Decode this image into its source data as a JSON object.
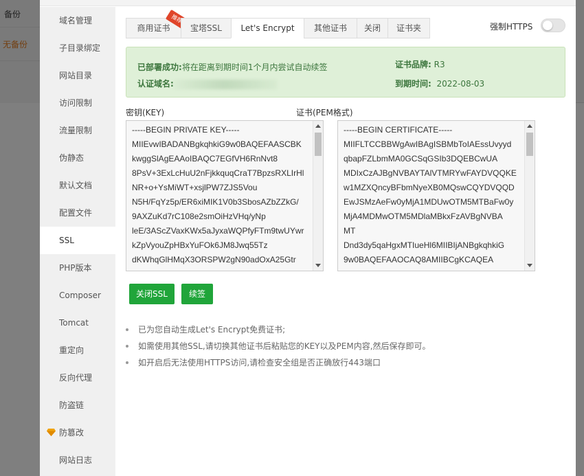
{
  "background": {
    "row1_label": "备份",
    "row2_label": "无备份"
  },
  "sidebar": {
    "items": [
      {
        "label": "域名管理"
      },
      {
        "label": "子目录绑定"
      },
      {
        "label": "网站目录"
      },
      {
        "label": "访问限制"
      },
      {
        "label": "流量限制"
      },
      {
        "label": "伪静态"
      },
      {
        "label": "默认文档"
      },
      {
        "label": "配置文件"
      },
      {
        "label": "SSL",
        "active": true
      },
      {
        "label": "PHP版本"
      },
      {
        "label": "Composer"
      },
      {
        "label": "Tomcat"
      },
      {
        "label": "重定向"
      },
      {
        "label": "反向代理"
      },
      {
        "label": "防盗链"
      },
      {
        "label": "防篡改",
        "icon": "gem-icon"
      },
      {
        "label": "网站日志"
      }
    ]
  },
  "tabs": [
    {
      "label": "商用证书",
      "badge": "推荐"
    },
    {
      "label": "宝塔SSL"
    },
    {
      "label": "Let's Encrypt",
      "active": true
    },
    {
      "label": "其他证书"
    },
    {
      "label": "关闭"
    },
    {
      "label": "证书夹"
    }
  ],
  "https_toggle": {
    "label": "强制HTTPS",
    "on": false
  },
  "info": {
    "status_label": "已部署成功:",
    "status_text": "将在距离到期时间1个月内尝试自动续签",
    "domain_label": "认证域名:",
    "brand_label": "证书品牌:",
    "brand_value": "R3",
    "expiry_label": "到期时间:",
    "expiry_value": "2022-08-03"
  },
  "key_field": {
    "label": "密钥(KEY)",
    "lines": [
      "-----BEGIN PRIVATE KEY-----",
      "MIIEvwIBADANBgkqhkiG9w0BAQEFAASCBK",
      "kwggSlAgEAAoIBAQC7EGfVH6RnNvt8",
      "8PsV+3ExLcHuU2nFjkkquqCraT7BpzsRXLIrHl",
      "NR+o+YsMiWT+xsjlPW7ZJS5Vou",
      "N5H/FqYz5p/ER6xiMIK1V0b3SbosAZbZZkG/",
      "9AXZuKd7rC108e2smOiHzVHq/yNp",
      "leE/3AScZVaxKWx5aJyxaWQPfyFTm9twUYwr",
      "kZpVyouZpHBxYuFOk6JM8Jwq55Tz",
      "dKWhqGlHMqX3ORSPW2gN90adOxA25Gtr"
    ]
  },
  "cert_field": {
    "label": "证书(PEM格式)",
    "lines": [
      "-----BEGIN CERTIFICATE-----",
      "MIIFLTCCBBWgAwIBAgISBMbToIAEssUvyyd",
      "qbapFZLbmMA0GCSqGSIb3DQEBCwUA",
      "MDIxCzAJBgNVBAYTAlVTMRYwFAYDVQQKE",
      "w1MZXQncyBFbmNyeXB0MQswCQYDVQQD",
      "EwJSMzAeFw0yMjA1MDUwOTM5MTBaFw0y",
      "MjA4MDMwOTM5MDlaMBkxFzAVBgNVBA",
      "MT",
      "Dnd3dy5qaHgxMTIueHl6MIIBIjANBgkqhkiG",
      "9w0BAQEFAAOCAQ8AMIIBCgKCAQEA"
    ]
  },
  "buttons": {
    "close_ssl": "关闭SSL",
    "renew": "续签"
  },
  "notes": [
    "已为您自动生成Let's Encrypt免费证书;",
    "如需使用其他SSL,请切换其他证书后粘贴您的KEY以及PEM内容,然后保存即可。",
    "如开启后无法使用HTTPS访问,请检查安全组是否正确放行443端口"
  ],
  "colors": {
    "accent_green": "#20a53a",
    "success_bg": "#dff0d8",
    "success_text": "#3c763d",
    "ribbon_red": "#e0452a"
  }
}
